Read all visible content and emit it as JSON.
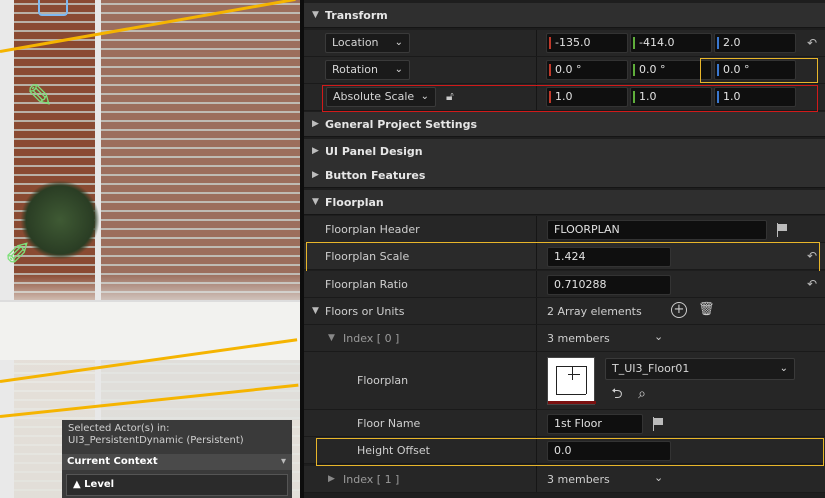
{
  "outliner": {
    "selected_line1": "Selected Actor(s) in:",
    "selected_line2": "UI3_PersistentDynamic (Persistent)",
    "current_context": "Current Context",
    "level_label": "Level"
  },
  "transform": {
    "header": "Transform",
    "location_label": "Location",
    "location": [
      "-135.0",
      "-414.0",
      "2.0"
    ],
    "rotation_label": "Rotation",
    "rotation": [
      "0.0 °",
      "0.0 °",
      "0.0 °"
    ],
    "scale_label": "Absolute Scale",
    "scale": [
      "1.0",
      "1.0",
      "1.0"
    ]
  },
  "sections": {
    "general": "General Project Settings",
    "ui_panel": "UI Panel Design",
    "button_features": "Button Features",
    "floorplan": "Floorplan"
  },
  "floorplan": {
    "header_label": "Floorplan Header",
    "header_value": "FLOORPLAN",
    "scale_label": "Floorplan Scale",
    "scale_value": "1.424",
    "ratio_label": "Floorplan Ratio",
    "ratio_value": "0.710288",
    "floors_label": "Floors or Units",
    "floors_value": "2 Array elements",
    "index0_label": "Index [ 0 ]",
    "index0_value": "3 members",
    "floorplan_label": "Floorplan",
    "asset_name": "T_UI3_Floor01",
    "floor_name_label": "Floor Name",
    "floor_name_value": "1st Floor",
    "height_offset_label": "Height Offset",
    "height_offset_value": "0.0",
    "index1_label": "Index [ 1 ]",
    "index1_value": "3 members"
  },
  "colors": {
    "x_axis": "#c0392b",
    "y_axis": "#5fae3b",
    "z_axis": "#3a78d0",
    "highlight_yellow": "#e8b62a",
    "highlight_red": "#d11a1a"
  },
  "icons": [
    "reset-arrow-icon",
    "lock-open-icon",
    "flag-icon",
    "plus-circle-icon",
    "trash-icon",
    "browse-arrow-icon",
    "find-asset-icon",
    "edit-pencil-icon",
    "chevron-down-icon"
  ]
}
